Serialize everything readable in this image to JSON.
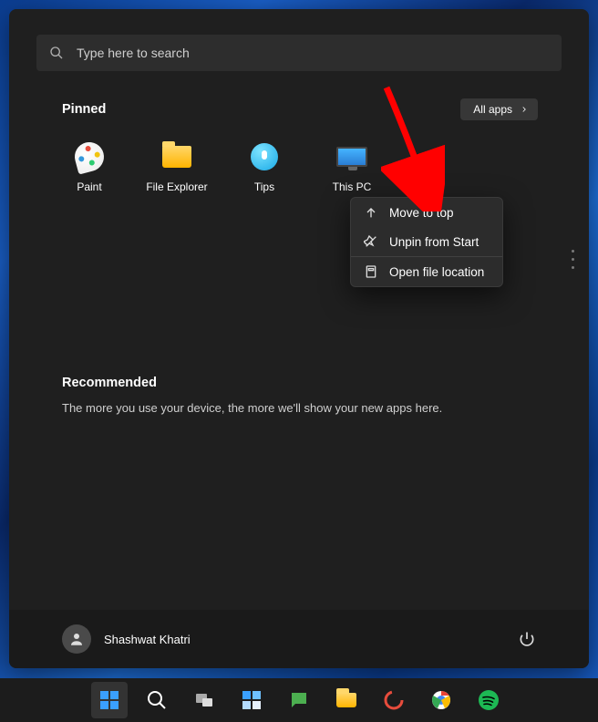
{
  "search": {
    "placeholder": "Type here to search"
  },
  "pinned": {
    "title": "Pinned",
    "all_apps_label": "All apps",
    "items": [
      {
        "label": "Paint",
        "icon": "paint-icon"
      },
      {
        "label": "File Explorer",
        "icon": "folder-icon"
      },
      {
        "label": "Tips",
        "icon": "lightbulb-icon"
      },
      {
        "label": "This PC",
        "icon": "monitor-icon"
      }
    ]
  },
  "context_menu": {
    "items": [
      {
        "label": "Move to top",
        "icon": "arrow-up-icon"
      },
      {
        "label": "Unpin from Start",
        "icon": "unpin-icon"
      },
      {
        "label": "Open file location",
        "icon": "file-location-icon"
      }
    ]
  },
  "recommended": {
    "title": "Recommended",
    "hint": "The more you use your device, the more we'll show your new apps here."
  },
  "user": {
    "name": "Shashwat Khatri"
  },
  "taskbar": {
    "items": [
      {
        "name": "start-button",
        "active": true
      },
      {
        "name": "search-button"
      },
      {
        "name": "task-view-button"
      },
      {
        "name": "widgets-button"
      },
      {
        "name": "chat-button"
      },
      {
        "name": "file-explorer-button"
      },
      {
        "name": "app-button-red"
      },
      {
        "name": "chrome-button"
      },
      {
        "name": "spotify-button"
      }
    ]
  },
  "annotation": {
    "arrow_color": "#ff0000"
  }
}
